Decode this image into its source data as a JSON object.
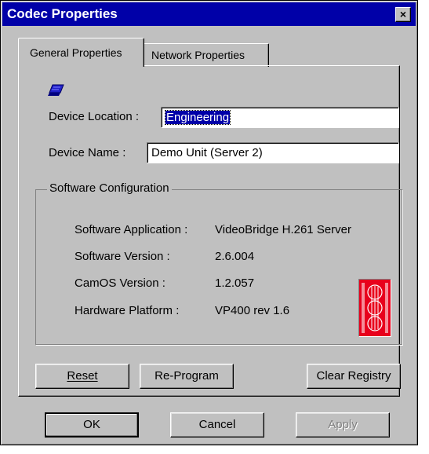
{
  "window": {
    "title": "Codec Properties",
    "close_glyph": "×"
  },
  "tabs": [
    {
      "label": "General Properties",
      "active": true
    },
    {
      "label": "Network Properties",
      "active": false
    }
  ],
  "device": {
    "icon": "device-icon",
    "location_label": "Device Location :",
    "location_value": "Engineering",
    "name_label": "Device Name :",
    "name_value": "Demo Unit (Server 2)"
  },
  "software": {
    "group_title": "Software Configuration",
    "rows": [
      {
        "label": "Software Application :",
        "value": "VideoBridge H.261 Server"
      },
      {
        "label": "Software Version :",
        "value": "2.6.004"
      },
      {
        "label": "CamOS Version :",
        "value": "1.2.057"
      },
      {
        "label": "Hardware Platform :",
        "value": "VP400 rev 1.6"
      }
    ],
    "badge_icon": "hardware-badge-icon",
    "badge_color": "#e8001c"
  },
  "actions": {
    "reset": {
      "label": "Reset",
      "mnemonic": "R"
    },
    "reprogram": {
      "label": "Re-Program",
      "mnemonic": "P"
    },
    "clear_registry": {
      "label": "Clear Registry",
      "mnemonic": "C"
    }
  },
  "footer": {
    "ok": "OK",
    "cancel": "Cancel",
    "apply": {
      "label": "Apply",
      "enabled": false
    }
  }
}
